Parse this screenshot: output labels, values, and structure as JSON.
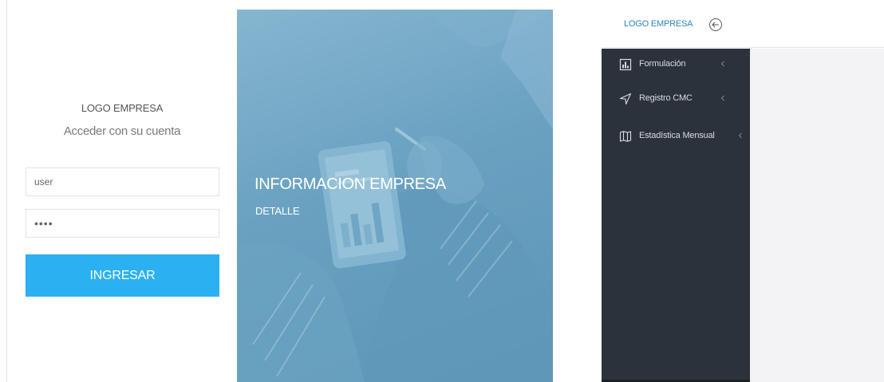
{
  "login": {
    "logo_text": "LOGO EMPRESA",
    "subtitle": "Acceder con su cuenta",
    "user_value": "user",
    "password_value": "••••",
    "submit_label": "INGRESAR",
    "button_color": "#2bb0f2"
  },
  "info": {
    "title": "INFORMACION EMPRESA",
    "detail": "DETALLE",
    "overlay_color": "#6aa1c1"
  },
  "dashboard": {
    "logo_text": "LOGO EMPRESA",
    "back_icon": "arrow-left-circle-icon",
    "sidebar_color": "#2b323c",
    "menu": [
      {
        "label": "Formulación",
        "icon": "bar-chart-icon"
      },
      {
        "label": "Registro CMC",
        "icon": "location-arrow-icon"
      },
      {
        "label": "Estadística Mensual",
        "icon": "map-icon"
      }
    ]
  }
}
